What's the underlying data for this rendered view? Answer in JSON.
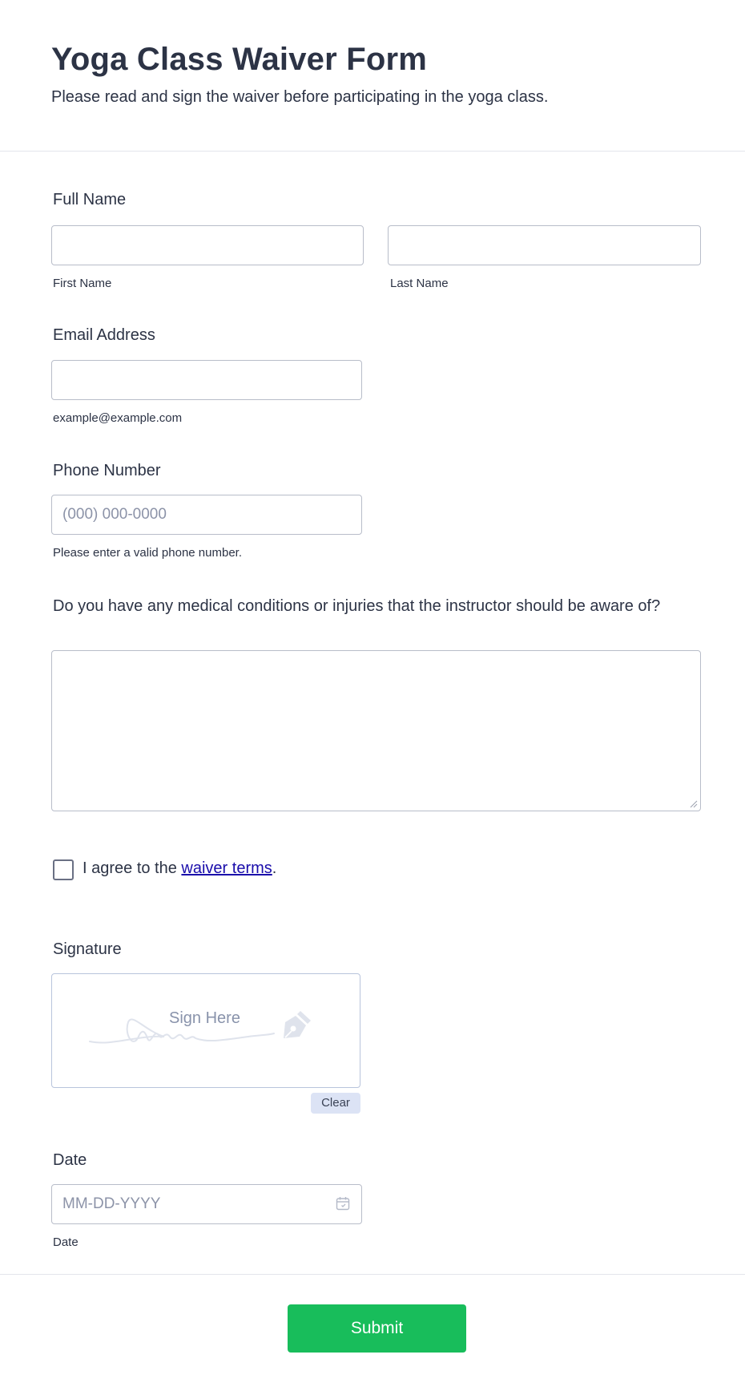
{
  "form": {
    "title": "Yoga Class Waiver Form",
    "subtitle": "Please read and sign the waiver before participating in the yoga class."
  },
  "full_name": {
    "label": "Full Name",
    "first_name_sublabel": "First Name",
    "last_name_sublabel": "Last Name",
    "first_name_value": "",
    "last_name_value": ""
  },
  "email": {
    "label": "Email Address",
    "sublabel": "example@example.com",
    "value": ""
  },
  "phone": {
    "label": "Phone Number",
    "placeholder": "(000) 000-0000",
    "sublabel": "Please enter a valid phone number.",
    "value": ""
  },
  "medical": {
    "label": "Do you have any medical conditions or injuries that the instructor should be aware of?",
    "value": ""
  },
  "agreement": {
    "prefix": "I agree to the ",
    "link_text": "waiver terms",
    "suffix": ".",
    "checked": false
  },
  "signature": {
    "label": "Signature",
    "placeholder": "Sign Here",
    "clear_label": "Clear",
    "icon": "pen-nib-icon"
  },
  "date": {
    "label": "Date",
    "placeholder": "MM-DD-YYYY",
    "sublabel": "Date",
    "icon": "calendar-icon"
  },
  "submit": {
    "label": "Submit",
    "color": "#18bd5b"
  }
}
